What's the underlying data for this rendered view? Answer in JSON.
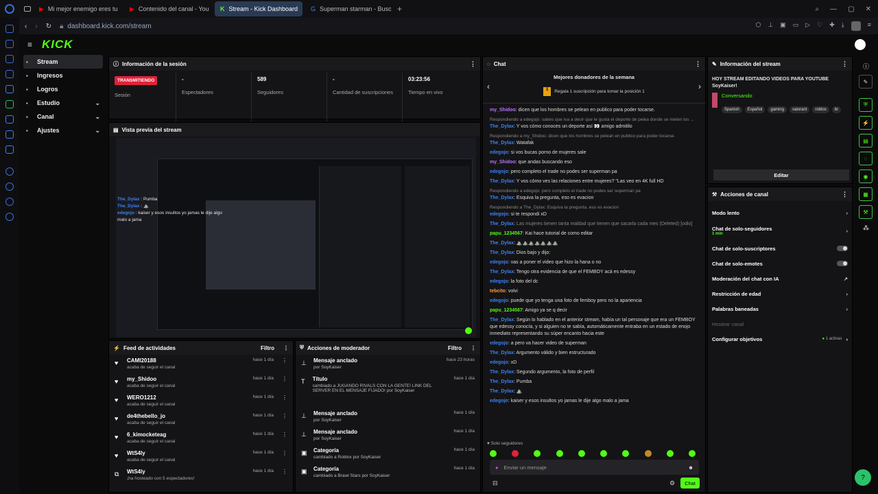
{
  "browser": {
    "tabs": [
      "Mi mejor enemigo eres tu",
      "Contenido del canal - You",
      "Stream - Kick Dashboard",
      "Superman starman - Busc"
    ],
    "url": "dashboard.kick.com/stream"
  },
  "brand": {
    "logo": "KICK",
    "accent": "#53fc18"
  },
  "nav": [
    {
      "label": "Stream",
      "icon": "stream-icon"
    },
    {
      "label": "Ingresos",
      "icon": "money-icon"
    },
    {
      "label": "Logros",
      "icon": "trophy-icon"
    },
    {
      "label": "Estudio",
      "icon": "studio-icon"
    },
    {
      "label": "Canal",
      "icon": "channel-icon"
    },
    {
      "label": "Ajustes",
      "icon": "gear-icon"
    }
  ],
  "session": {
    "title": "Información de la sesión",
    "status": "TRANSMITIENDO",
    "status_label": "Sesión",
    "stats": [
      {
        "value": "-",
        "label": "Espectadores"
      },
      {
        "value": "589",
        "label": "Seguidores"
      },
      {
        "value": "-",
        "label": "Cantidad de suscripciones"
      },
      {
        "value": "03:23:56",
        "label": "Tiempo en vivo"
      }
    ]
  },
  "preview": {
    "title": "Vista previa del stream"
  },
  "feed": {
    "title": "Feed de actividades",
    "filter": "Filtro",
    "rows": [
      {
        "name": "CAMI20188",
        "sub": "acaba de seguir el canal",
        "time": "hace 1 día"
      },
      {
        "name": "my_Shidoo",
        "sub": "acaba de seguir el canal",
        "time": "hace 1 día"
      },
      {
        "name": "WERO1212",
        "sub": "acaba de seguir el canal",
        "time": "hace 1 día"
      },
      {
        "name": "de4thebello_jo",
        "sub": "acaba de seguir el canal",
        "time": "hace 1 día"
      },
      {
        "name": "6_kimocketeag",
        "sub": "acaba de seguir el canal",
        "time": "hace 1 día"
      },
      {
        "name": "WtS4ly",
        "sub": "acaba de seguir el canal",
        "time": "hace 1 día"
      },
      {
        "name": "WtS4ly",
        "sub": "¡ha hosteado con 5 espectadores!",
        "time": "hace 1 día"
      }
    ]
  },
  "mod": {
    "title": "Acciones de moderador",
    "filter": "Filtro",
    "rows": [
      {
        "name": "Mensaje anclado",
        "sub": "por SoyKaiser",
        "time": "hace 23 horas"
      },
      {
        "name": "Título",
        "sub": "cambiado a JUGANDO RIVALS CON LA GENTE! LINK DEL SERVER EN EL MENSAJE FIJADO! por SoyKaiser",
        "time": "hace 1 día"
      },
      {
        "name": "Mensaje anclado",
        "sub": "por SoyKaiser",
        "time": "hace 1 día"
      },
      {
        "name": "Mensaje anclado",
        "sub": "por SoyKaiser",
        "time": "hace 1 día"
      },
      {
        "name": "Categoría",
        "sub": "cambiado a Roblox por SoyKaiser",
        "time": "hace 1 día"
      },
      {
        "name": "Categoría",
        "sub": "cambiado a Brawl Stars por SoyKaiser",
        "time": "hace 1 día"
      }
    ]
  },
  "chat": {
    "title": "Chat",
    "donors_title": "Mejores donadores de la semana",
    "donors_sub": "Regala 1 suscripción para tomar la posición 1",
    "placeholder": "Enviar un mensaje",
    "send": "Chat",
    "followers_only": "Solo seguidores",
    "lines": [
      {
        "user": "my_Shidoo",
        "color": "#b774ff",
        "text": "dicen que los hombres se pelean en publico para poder tocarse."
      },
      {
        "rep": "Respondiendo a edegojo: sabes que iva a decir que le gusta el deporte de pelea donde se meten los ...",
        "user": "The_Dylax",
        "color": "#3b82f6",
        "text": "Y vos cómo conoces un deporte así 👀 amigo admitilo"
      },
      {
        "rep": "Respondiendo a my_Shidoo: dicen que los hombres se pelean en publico para poder tocarse.",
        "user": "The_Dylax",
        "color": "#3b82f6",
        "text": "Watafak"
      },
      {
        "user": "edegojo",
        "color": "#3b82f6",
        "text": "si vos bucas porno de mujeres sale"
      },
      {
        "user": "my_Shidoo",
        "color": "#b774ff",
        "text": "que andas buscando eso"
      },
      {
        "user": "edegojo",
        "color": "#3b82f6",
        "text": "pero completo el trade no podes ser superman pa"
      },
      {
        "user": "The_Dylax",
        "color": "#3b82f6",
        "text": "Y vos cómo ves las relaciones entre mujeres? \"Las veo en 4K full HD"
      },
      {
        "rep": "Respondiendo a edegojo: pero completo el trade no podes ser superman pa",
        "user": "The_Dylax",
        "color": "#3b82f6",
        "text": "Esquiva la pregunta, eso es evacion"
      },
      {
        "rep": "Respondiendo a The_Dylax: Esquiva la pregunta, eso es evacion",
        "user": "edegojo",
        "color": "#3b82f6",
        "text": "si te respondi xD"
      },
      {
        "user": "The_Dylax",
        "color": "#3b82f6",
        "text": "Las mujeres tienen tanta maldad que tienen que sacarla cada mes (Deleted) [odio]"
      },
      {
        "user": "papu_1234567",
        "color": "#53fc18",
        "text": "Kai hace tutorial de como editar"
      },
      {
        "user": "The_Dylax",
        "color": "#3b82f6",
        "text": "⛰️⛰️⛰️⛰️⛰️⛰️⛰️"
      },
      {
        "user": "The_Dylax",
        "color": "#3b82f6",
        "text": "Dios bajo y dijo:"
      },
      {
        "user": "edegojo",
        "color": "#3b82f6",
        "text": "vas a poner el video que hizo la hana o no"
      },
      {
        "user": "The_Dylax",
        "color": "#3b82f6",
        "text": "Tengo otra evidencia de que el FEMBOY acá es edessy"
      },
      {
        "user": "edegojo",
        "color": "#3b82f6",
        "text": "la foto del dc"
      },
      {
        "user": "tebcito",
        "color": "#ff9a3c",
        "text": "volvi"
      },
      {
        "user": "edegojo",
        "color": "#3b82f6",
        "text": "puede que yo tenga una foto de femboy pero no la apariencia"
      },
      {
        "user": "papu_1234567",
        "color": "#53fc18",
        "text": "Amigo ya se q decir"
      },
      {
        "user": "The_Dylax",
        "color": "#3b82f6",
        "text": "Según lo hablado en el anterior stream, había un tal personaje que era un FEMBOY que edessy conocía, y si alguien no te sabía, automáticamente entraba en un estado de enojo inmediato representando su súper encanto hacia este"
      },
      {
        "user": "edegojo",
        "color": "#3b82f6",
        "text": "a pero va hacer video de superman"
      },
      {
        "user": "The_Dylax",
        "color": "#3b82f6",
        "text": "Argumento válido y bien estructurado"
      },
      {
        "user": "edegojo",
        "color": "#3b82f6",
        "text": "xD"
      },
      {
        "user": "The_Dylax",
        "color": "#3b82f6",
        "text": "Segundo argumento, la foto de perfil"
      },
      {
        "user": "The_Dylax",
        "color": "#3b82f6",
        "text": "Pumba"
      },
      {
        "user": "The_Dylax",
        "color": "#3b82f6",
        "text": "⛰️"
      },
      {
        "user": "edegojo",
        "color": "#3b82f6",
        "text": "kaiser y esos insultos yo jamas le dije algo malo a jama"
      }
    ]
  },
  "stream_info": {
    "title": "Información del stream",
    "stream_title": "HOY STREAM EDITANDO VIDEOS PARA YOUTUBE",
    "channel": "SoyKaiser!",
    "category": "Conversando",
    "tags": [
      "Spanish",
      "Español",
      "gaming",
      "valorant",
      "roblox",
      "br"
    ],
    "edit": "Editar"
  },
  "channel_actions": {
    "title": "Acciones de canal",
    "rows": [
      {
        "label": "Modo lento",
        "type": "arrow"
      },
      {
        "label": "Chat de solo-seguidores",
        "sub": "1 min",
        "type": "arrow"
      },
      {
        "label": "Chat de solo-suscriptores",
        "type": "toggle"
      },
      {
        "label": "Chat de solo-emotes",
        "type": "toggle"
      },
      {
        "label": "Moderación del chat con IA",
        "type": "ext"
      },
      {
        "label": "Restricción de edad",
        "type": "arrow"
      },
      {
        "label": "Palabras baneadas",
        "type": "arrow"
      },
      {
        "label": "Hostear canal",
        "type": "disabled"
      },
      {
        "label": "Configurar objetivos",
        "sub": "1 activas",
        "type": "arrow"
      }
    ]
  }
}
